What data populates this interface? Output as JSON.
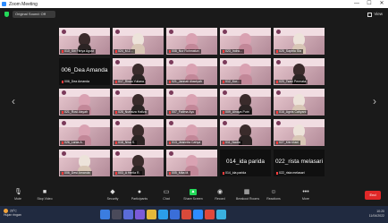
{
  "window": {
    "title": "Zoom Meeting",
    "controls": [
      "—",
      "☐",
      "✕"
    ]
  },
  "topbar": {
    "sound_label": "Original Sound: Off",
    "view_label": "View"
  },
  "gallery": {
    "tiles": [
      {
        "name": "010_Siti Fitriya Agust",
        "kind": "photo",
        "person": "dark"
      },
      {
        "name": "024_M.Z...",
        "kind": "photo",
        "person": "light",
        "speaking": true
      },
      {
        "name": "008_Nur Rohmatun",
        "kind": "photo",
        "person": "pink"
      },
      {
        "name": "023_Indra...",
        "kind": "photo",
        "person": "pink"
      },
      {
        "name": "025_Saptria Sia",
        "kind": "photo",
        "person": "light"
      },
      {
        "name": "006_Dea Amanda",
        "kind": "text",
        "big": "006_Dea Amanda"
      },
      {
        "name": "017_Riska Yuliana",
        "kind": "photo",
        "person": "dark"
      },
      {
        "name": "021_Jannati Alawiyah",
        "kind": "photo",
        "person": "pink"
      },
      {
        "name": "012_Kur...",
        "kind": "photo",
        "person": "pink"
      },
      {
        "name": "020_Tsani Permata",
        "kind": "photo",
        "person": "dark"
      },
      {
        "name": "021_Rosi Aisyah",
        "kind": "photo",
        "person": "pink"
      },
      {
        "name": "028_Nurfaiza Hafiza",
        "kind": "photo",
        "person": "dark"
      },
      {
        "name": "007_Fatima Ayu",
        "kind": "photo",
        "person": "pink"
      },
      {
        "name": "009_Ainaya Putri",
        "kind": "photo",
        "person": "dark"
      },
      {
        "name": "016_Agnis Cahyani",
        "kind": "photo",
        "person": "light"
      },
      {
        "name": "026_Laras A.",
        "kind": "photo",
        "person": "pink"
      },
      {
        "name": "018_Nisa S.",
        "kind": "photo",
        "person": "dark"
      },
      {
        "name": "013_Jeannita Cahya",
        "kind": "photo",
        "person": "pink"
      },
      {
        "name": "011_Nadia",
        "kind": "photo",
        "person": "dark"
      },
      {
        "name": "027_Kiki Iriani",
        "kind": "photo",
        "person": "light"
      },
      {
        "name": "006_Desi Amanda",
        "kind": "photo",
        "person": "light"
      },
      {
        "name": "003_A Herlia R.",
        "kind": "photo",
        "person": "dark"
      },
      {
        "name": "005_Mita M.",
        "kind": "photo",
        "person": "pink"
      },
      {
        "name": "014_ida parida",
        "kind": "text",
        "big": "014_ida parida"
      },
      {
        "name": "022_rista melasari",
        "kind": "text",
        "big": "022_rista melasari"
      }
    ]
  },
  "toolbar": {
    "unmute": "Mute",
    "video": "Stop Video",
    "security": "Security",
    "participants": "Participants",
    "chat": "Chat",
    "share": "Share Screen",
    "record": "Record",
    "breakout": "Breakout Rooms",
    "reactions": "Reactions",
    "more": "More",
    "end": "End"
  },
  "taskbar": {
    "temp": "26°C",
    "weather": "Hujan ringan",
    "time": "10:20",
    "date": "11/04/2022"
  },
  "colors": {
    "accent_green": "#23d959",
    "end_red": "#e02828",
    "toolbar_bg": "#1a1a1a",
    "taskbar_bg": "#202a40"
  }
}
